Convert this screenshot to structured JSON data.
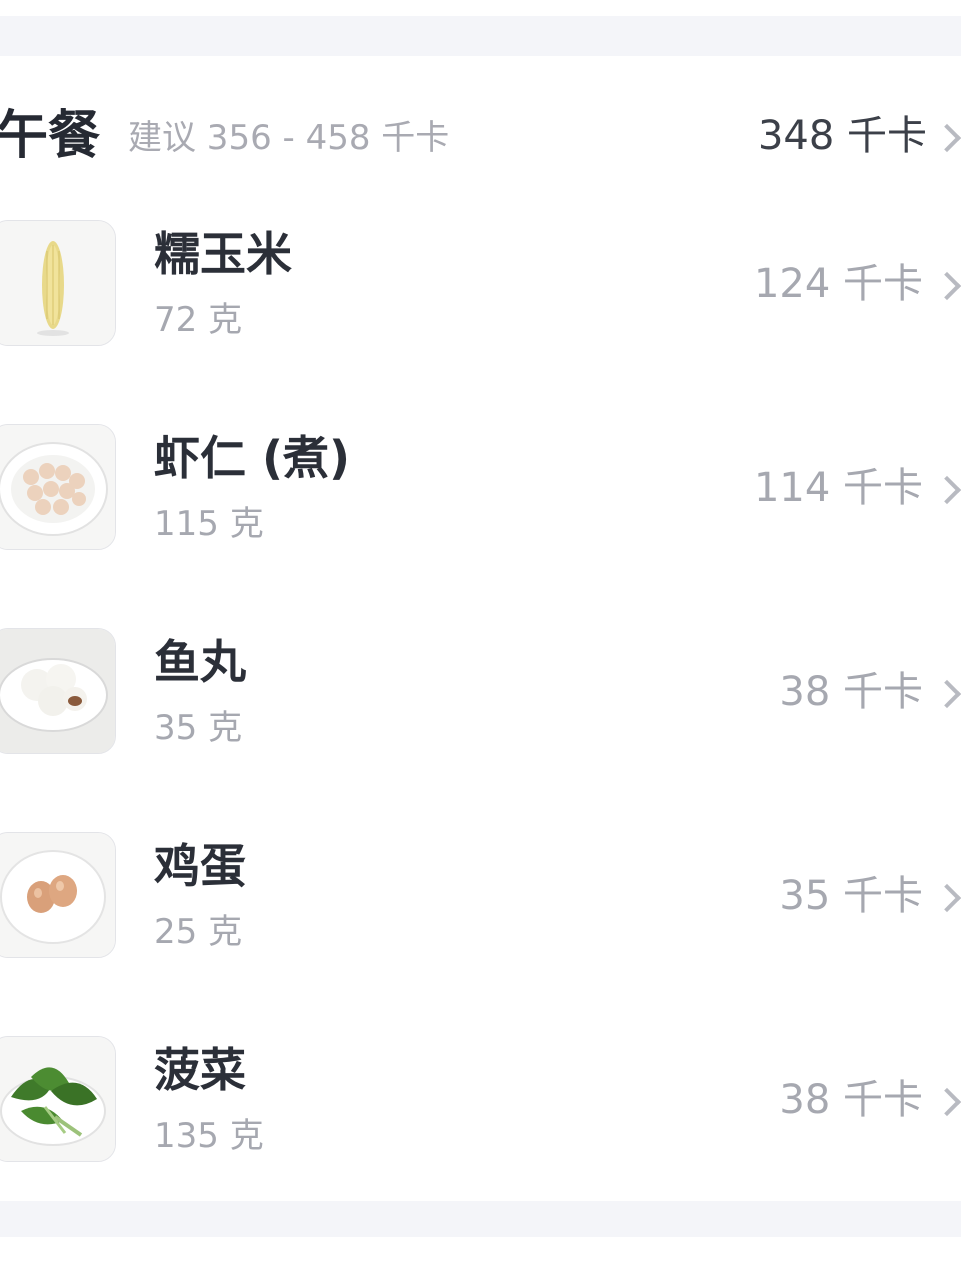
{
  "meal": {
    "title": "午餐",
    "suggestion": "建议 356 - 458 千卡",
    "total": "348 千卡"
  },
  "foods": [
    {
      "name": "糯玉米",
      "weight": "72 克",
      "kcal": "124 千卡",
      "icon": "corn-icon"
    },
    {
      "name": "虾仁 (煮)",
      "weight": "115 克",
      "kcal": "114 千卡",
      "icon": "shrimp-icon"
    },
    {
      "name": "鱼丸",
      "weight": "35 克",
      "kcal": "38 千卡",
      "icon": "fishball-icon"
    },
    {
      "name": "鸡蛋",
      "weight": "25 克",
      "kcal": "35 千卡",
      "icon": "egg-icon"
    },
    {
      "name": "菠菜",
      "weight": "135 克",
      "kcal": "38 千卡",
      "icon": "spinach-icon"
    }
  ],
  "colors": {
    "background": "#ffffff",
    "divider_band": "#f4f5f9",
    "title_text": "#262a33",
    "secondary_text": "#a6a8b0",
    "chevron": "#b8bac1"
  }
}
